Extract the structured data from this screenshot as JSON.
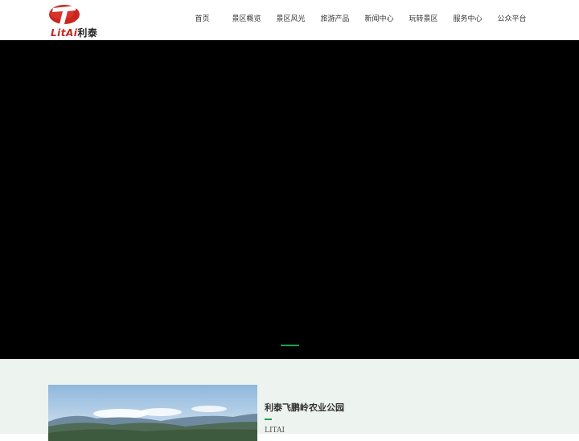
{
  "header": {
    "logo": {
      "text_en": "LitAi",
      "text_cn": "利泰"
    },
    "nav": [
      {
        "label": "首页"
      },
      {
        "label": "景区概览"
      },
      {
        "label": "景区风光"
      },
      {
        "label": "旅游产品"
      },
      {
        "label": "新闻中心"
      },
      {
        "label": "玩转景区"
      },
      {
        "label": "服务中心"
      },
      {
        "label": "公众平台"
      }
    ]
  },
  "hero": {
    "active_slide": 1,
    "colors": {
      "background": "#000000",
      "indicator": "#1aa34a"
    }
  },
  "feature": {
    "title": "利泰飞鹏岭农业公园",
    "subtitle": "LITAI",
    "colors": {
      "section_bg": "#edf3ef",
      "accent": "#1aa34a"
    }
  }
}
